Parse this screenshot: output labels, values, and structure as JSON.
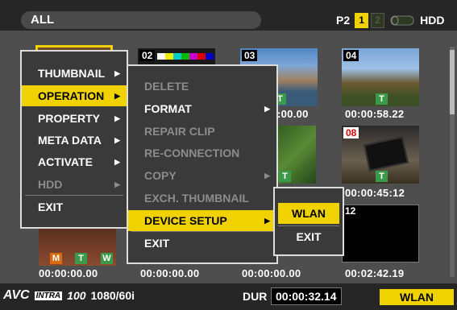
{
  "header": {
    "title": "ALL",
    "slot_label": "P2",
    "slot1": "1",
    "slot2": "2",
    "hdd_label": "HDD"
  },
  "thumbnails": [
    {
      "number": "",
      "timecode": "00:00:00.00",
      "badges": [
        "M",
        "T",
        "W"
      ]
    },
    {
      "number": "02",
      "timecode": "00:00:00.00",
      "badges": []
    },
    {
      "number": "03",
      "timecode": ":00.00",
      "badges": [
        "T"
      ]
    },
    {
      "number": "04",
      "timecode": "00:00:58.22",
      "badges": [
        "T"
      ]
    },
    {
      "number": "",
      "timecode": "",
      "badges": [
        "T"
      ]
    },
    {
      "number": "08",
      "timecode": "00:00:45:12",
      "badges": [
        "T"
      ]
    },
    {
      "number": "12",
      "timecode": "00:02:42.19",
      "badges": []
    },
    {
      "number": "",
      "timecode": "00:00:00.00",
      "badges": []
    }
  ],
  "main_menu": [
    {
      "label": "THUMBNAIL",
      "arrow": "▶",
      "state": "normal"
    },
    {
      "label": "OPERATION",
      "arrow": "▶",
      "state": "selected"
    },
    {
      "label": "PROPERTY",
      "arrow": "▶",
      "state": "normal"
    },
    {
      "label": "META DATA",
      "arrow": "▶",
      "state": "normal"
    },
    {
      "label": "ACTIVATE",
      "arrow": "▶",
      "state": "normal"
    },
    {
      "label": "HDD",
      "arrow": "▶",
      "state": "disabled"
    },
    {
      "label": "EXIT",
      "arrow": "",
      "state": "normal"
    }
  ],
  "operation_menu": [
    {
      "label": "DELETE",
      "arrow": "",
      "state": "disabled"
    },
    {
      "label": "FORMAT",
      "arrow": "▶",
      "state": "normal"
    },
    {
      "label": "REPAIR CLIP",
      "arrow": "",
      "state": "disabled"
    },
    {
      "label": "RE-CONNECTION",
      "arrow": "",
      "state": "disabled"
    },
    {
      "label": "COPY",
      "arrow": "▶",
      "state": "disabled"
    },
    {
      "label": "EXCH. THUMBNAIL",
      "arrow": "",
      "state": "disabled"
    },
    {
      "label": "DEVICE SETUP",
      "arrow": "▶",
      "state": "selected"
    },
    {
      "label": "EXIT",
      "arrow": "",
      "state": "normal"
    }
  ],
  "device_menu": [
    {
      "label": "WLAN",
      "state": "selected"
    },
    {
      "label": "EXIT",
      "state": "normal"
    }
  ],
  "footer": {
    "codec_logo": "AVC",
    "codec_sub": "INTRA",
    "codec_rate": "100",
    "format": "1080/60i",
    "dur_label": "DUR",
    "duration": "00:00:32.14",
    "wlan_badge": "WLAN"
  },
  "colors": {
    "accent": "#f0d200",
    "menu_bg": "#3a3a3a",
    "badge_green": "#3a9a4a"
  }
}
